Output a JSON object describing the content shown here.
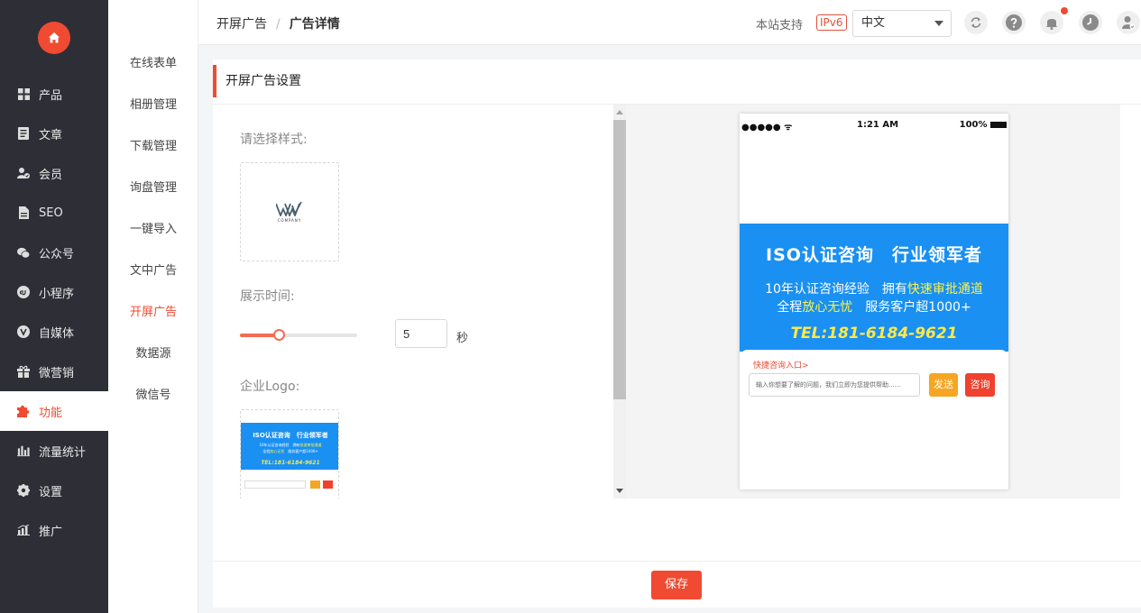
{
  "sidebar": {
    "items": [
      {
        "label": "产品",
        "icon": "grid-icon"
      },
      {
        "label": "文章",
        "icon": "document-icon"
      },
      {
        "label": "会员",
        "icon": "member-icon"
      },
      {
        "label": "SEO",
        "icon": "file-icon"
      },
      {
        "label": "公众号",
        "icon": "wechat-icon"
      },
      {
        "label": "小程序",
        "icon": "mini-program-icon"
      },
      {
        "label": "自媒体",
        "icon": "media-icon"
      },
      {
        "label": "微营销",
        "icon": "gift-icon"
      },
      {
        "label": "功能",
        "icon": "puzzle-icon"
      },
      {
        "label": "流量统计",
        "icon": "bar-chart-icon"
      },
      {
        "label": "设置",
        "icon": "gear-icon"
      },
      {
        "label": "推广",
        "icon": "promote-icon"
      }
    ],
    "active": "功能"
  },
  "submenu": {
    "items": [
      "在线表单",
      "相册管理",
      "下载管理",
      "询盘管理",
      "一键导入",
      "文中广告",
      "开屏广告",
      "数据源",
      "微信号"
    ],
    "active": "开屏广告"
  },
  "header": {
    "breadcrumb_parent": "开屏广告",
    "breadcrumb_separator": "/",
    "breadcrumb_current": "广告详情",
    "support_text": "本站支持",
    "ipv6_badge": "IPv6",
    "language": "中文"
  },
  "card": {
    "title": "开屏广告设置",
    "style_label": "请选择样式:",
    "style_logo_text": "COMPANY",
    "duration_label": "展示时间:",
    "duration_value": "5",
    "duration_fraction": 0.33,
    "duration_unit": "秒",
    "logo_label": "企业Logo:",
    "save_label": "保存"
  },
  "preview": {
    "signal": "●●●●● ᯤ",
    "time": "1:21 AM",
    "battery": "100%",
    "banner_title": "ISO认证咨询　行业领军者",
    "line1_a": "10年认证咨询经验　拥有",
    "line1_b": "快速审批通道",
    "line2_a": "全程",
    "line2_b": "放心无忧",
    "line2_c": "　服务客户超1000+",
    "tel": "TEL:181-6184-9621",
    "consult_link": "快捷咨询入口>",
    "input_placeholder": "输入你想要了解的问题，我们立即为您提供帮助......",
    "send_label": "发送",
    "ask_label": "咨询"
  },
  "colors": {
    "accent": "#f04a32",
    "sidebar_bg": "#2e2f36",
    "banner_blue": "#1990f2",
    "highlight_yellow": "#fff24a"
  }
}
